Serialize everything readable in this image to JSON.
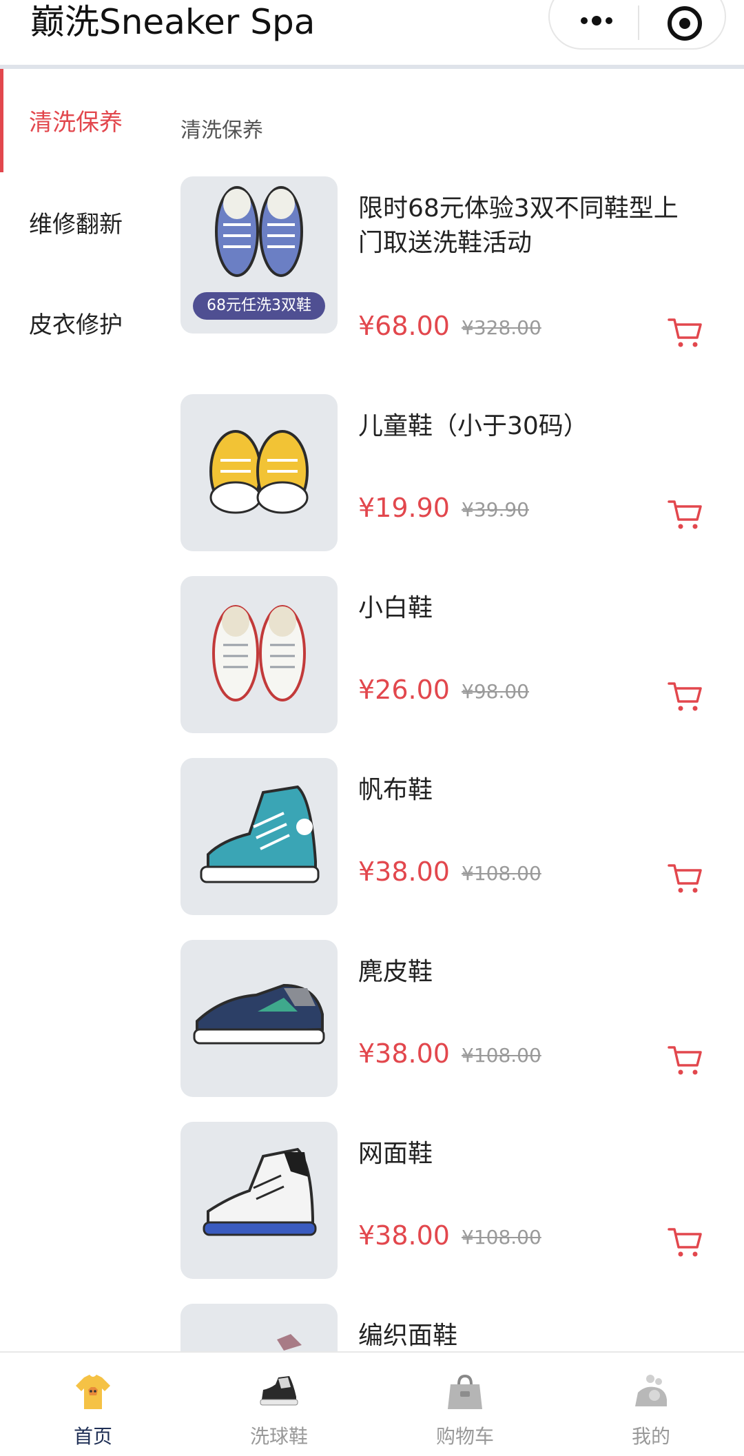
{
  "header": {
    "title": "巅洗Sneaker Spa",
    "more_icon": "more-dots-icon",
    "mini_program_icon": "target-circle-icon"
  },
  "sidebar": {
    "items": [
      {
        "label": "清洗保养",
        "active": true
      },
      {
        "label": "维修翻新",
        "active": false
      },
      {
        "label": "皮衣修护",
        "active": false
      }
    ]
  },
  "section": {
    "title": "清洗保养"
  },
  "products": [
    {
      "name": "限时68元体验3双不同鞋型上门取送洗鞋活动",
      "price": "¥68.00",
      "original_price": "¥328.00",
      "badge": "68元任洗3双鞋",
      "image": "blue-canvas-shoes"
    },
    {
      "name": "儿童鞋（小于30码）",
      "price": "¥19.90",
      "original_price": "¥39.90",
      "image": "yellow-kids-shoes"
    },
    {
      "name": "小白鞋",
      "price": "¥26.00",
      "original_price": "¥98.00",
      "image": "white-sneakers"
    },
    {
      "name": "帆布鞋",
      "price": "¥38.00",
      "original_price": "¥108.00",
      "image": "teal-high-top"
    },
    {
      "name": "麂皮鞋",
      "price": "¥38.00",
      "original_price": "¥108.00",
      "image": "suede-runner"
    },
    {
      "name": "网面鞋",
      "price": "¥38.00",
      "original_price": "¥108.00",
      "image": "mesh-basketball-shoe"
    },
    {
      "name": "编织面鞋",
      "image": "knit-shoe"
    }
  ],
  "colors": {
    "accent": "#e2474d",
    "thumb_bg": "#e5e8ec",
    "badge_bg": "#4f4f92",
    "tab_active": "#1f2f55"
  },
  "tabbar": {
    "items": [
      {
        "label": "首页",
        "icon": "home-tshirt-icon",
        "active": true
      },
      {
        "label": "洗球鞋",
        "icon": "sneaker-icon",
        "active": false
      },
      {
        "label": "购物车",
        "icon": "shopping-bag-icon",
        "active": false
      },
      {
        "label": "我的",
        "icon": "profile-bubbles-icon",
        "active": false
      }
    ]
  }
}
